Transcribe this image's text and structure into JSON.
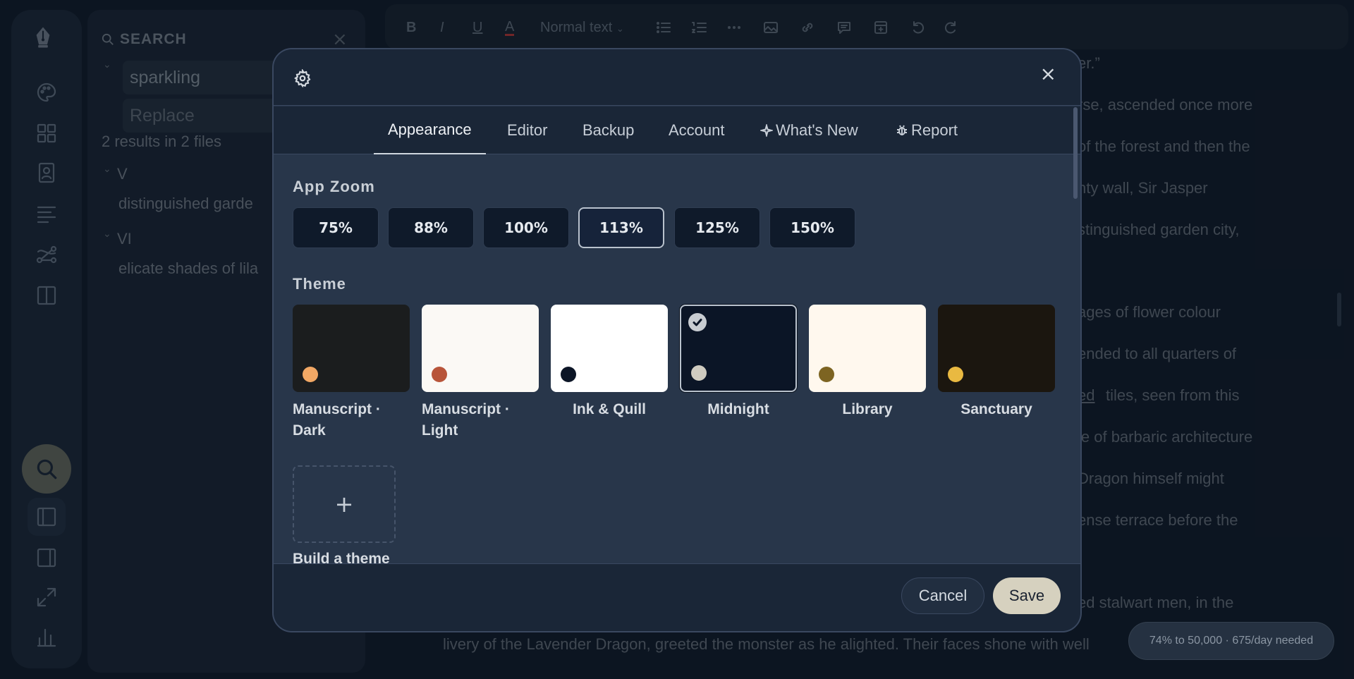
{
  "search_panel": {
    "title": "SEARCH",
    "query": "sparkling",
    "replace_placeholder": "Replace",
    "summary": "2 results in 2 files",
    "groups": [
      {
        "name": "V",
        "match": "distinguished garde"
      },
      {
        "name": "VI",
        "match": "elicate shades of lila"
      }
    ]
  },
  "toolbar": {
    "style_select": "Normal text"
  },
  "editor_lines": [
    "er.”",
    "rse, ascended once more",
    "of the forest and then the",
    "hty wall, Sir Jasper",
    "stinguished garden city,",
    "ages of flower colour",
    "ended to all quarters of",
    "ed",
    "tiles, seen from this",
    "le of barbaric architecture",
    "Dragon himself might",
    "ense terrace before the",
    "ed stalwart men, in the",
    "livery of the Lavender Dragon, greeted the monster as he alighted. Their faces shone with well"
  ],
  "word_goal": "74% to 50,000 · 675/day needed",
  "settings": {
    "tabs": [
      {
        "label": "Appearance",
        "icon": ""
      },
      {
        "label": "Editor",
        "icon": ""
      },
      {
        "label": "Backup",
        "icon": ""
      },
      {
        "label": "Account",
        "icon": ""
      },
      {
        "label": "What's New",
        "icon": "sparkle-icon"
      },
      {
        "label": "Report",
        "icon": "bug-icon"
      }
    ],
    "active_tab": "Appearance",
    "zoom_title": "App Zoom",
    "zoom_options": [
      "75%",
      "88%",
      "100%",
      "113%",
      "125%",
      "150%"
    ],
    "zoom_selected": "113%",
    "theme_title": "Theme",
    "themes": [
      {
        "name": "Manuscript · Dark",
        "bg": "#1b1d1e",
        "dot": "#f2a865"
      },
      {
        "name": "Manuscript · Light",
        "bg": "#fbf9f5",
        "dot": "#b8553a"
      },
      {
        "name": "Ink & Quill",
        "bg": "#ffffff",
        "dot": "#0c1526"
      },
      {
        "name": "Midnight",
        "bg": "#0b1526",
        "dot": "#cfcbc0"
      },
      {
        "name": "Library",
        "bg": "#fff8ee",
        "dot": "#7d6422"
      },
      {
        "name": "Sanctuary",
        "bg": "#1b160f",
        "dot": "#e9b941"
      }
    ],
    "theme_selected": "Midnight",
    "build_theme_label": "Build a theme",
    "cancel_label": "Cancel",
    "save_label": "Save"
  },
  "colors": {
    "accent_save": "#d6d1bf",
    "modal_bg": "#28364a"
  }
}
